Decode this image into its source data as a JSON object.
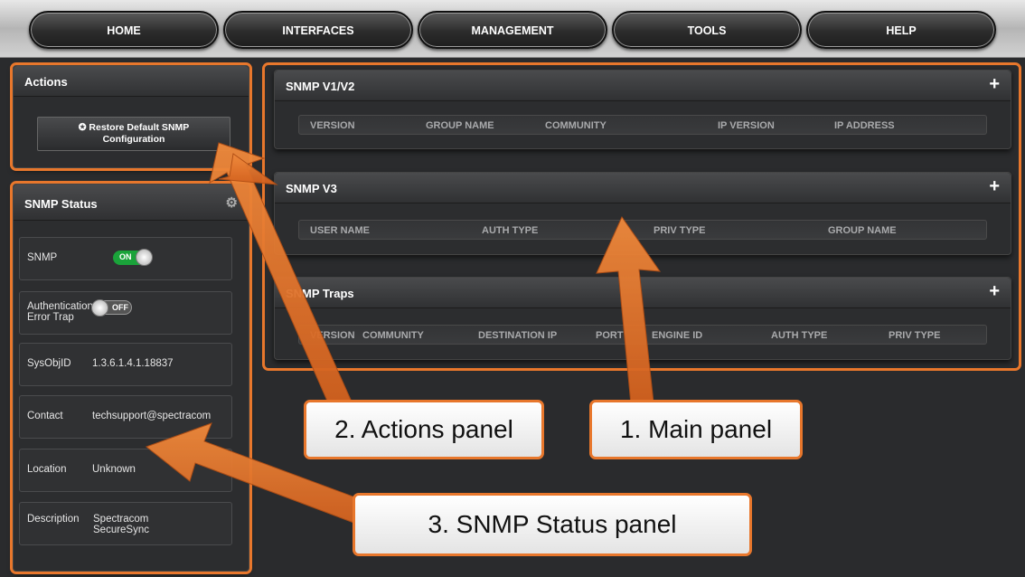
{
  "nav": {
    "items": [
      "HOME",
      "INTERFACES",
      "MANAGEMENT",
      "TOOLS",
      "HELP"
    ]
  },
  "actions": {
    "title": "Actions",
    "restore_button": "✪ Restore Default SNMP Configuration"
  },
  "status": {
    "title": "SNMP Status",
    "snmp_label": "SNMP",
    "snmp_toggle": "ON",
    "auth_label": "Authentication Error Trap",
    "auth_toggle": "OFF",
    "sysobj_label": "SysObjID",
    "sysobj_value": "1.3.6.1.4.1.18837",
    "contact_label": "Contact",
    "contact_value": "techsupport@spectracom",
    "location_label": "Location",
    "location_value": "Unknown",
    "description_label": "Description",
    "description_value": "Spectracom SecureSync"
  },
  "main": {
    "v1v2": {
      "title": "SNMP V1/V2",
      "add": "+",
      "columns": [
        "VERSION",
        "GROUP NAME",
        "COMMUNITY",
        "IP VERSION",
        "IP ADDRESS"
      ]
    },
    "v3": {
      "title": "SNMP V3",
      "add": "+",
      "columns": [
        "USER NAME",
        "AUTH TYPE",
        "PRIV TYPE",
        "GROUP NAME"
      ]
    },
    "traps": {
      "title": "SNMP Traps",
      "add": "+",
      "columns": [
        "VERSION",
        "COMMUNITY",
        "DESTINATION IP",
        "PORT",
        "ENGINE ID",
        "AUTH TYPE",
        "PRIV TYPE"
      ]
    }
  },
  "callouts": {
    "main": "1. Main panel",
    "actions": "2. Actions panel",
    "status": "3. SNMP Status panel"
  },
  "colors": {
    "highlight": "#e8772c",
    "toggle_on": "#1aa33a"
  }
}
